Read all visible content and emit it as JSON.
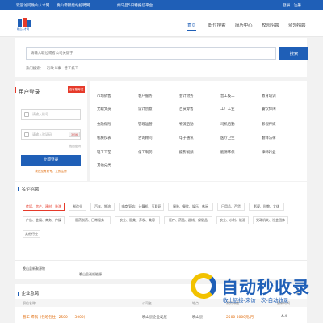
{
  "topbar": {
    "welcome": "欢迎访问晚山人才网",
    "site_name": "晚山零聚能站招聘网",
    "slogan": "如马品5日特报信平台",
    "links": "登录 | 注册"
  },
  "header": {
    "logo_text": "晚山人才网",
    "nav": [
      "首页",
      "职位搜索",
      "简历中心",
      "校园招聘",
      "蓝领招聘"
    ]
  },
  "search": {
    "placeholder": "请输入职位或者公司关键字",
    "button": "搜索",
    "hot_label": "热门搜索：",
    "hot_terms": [
      "行政人事",
      "普工技工"
    ]
  },
  "login": {
    "title": "用户登录",
    "tag": "没有账号注册",
    "username_placeholder": "请输入账号",
    "password_placeholder": "请输入验证码",
    "captcha": "3256",
    "forgot": "找回密码",
    "button": "立即登录",
    "register_hint": "我还没有账号，立即注册"
  },
  "categories": {
    "col1": [
      "市场销售",
      "文职文员",
      "金融保险",
      "机械仪表",
      "轻工工艺",
      "其他分类"
    ],
    "col2": [
      "客户服务",
      "设计创意",
      "管理运营",
      "咨询顾问",
      "化工制药"
    ],
    "col3": [
      "会计财务",
      "百货零售",
      "物流后勤",
      "电子通讯",
      "摄影视频"
    ],
    "col4": [
      "普工技工",
      "工厂工业",
      "司机后勤",
      "医疗卫生",
      "能源环保"
    ],
    "col5": [
      "教育培训",
      "餐饮休闲",
      "影视传媒",
      "翻译法律",
      "律师行业"
    ]
  },
  "industry": {
    "title": "名企招聘",
    "row1": [
      "传媒、房产、建材、装潢",
      "制造业",
      "汽车、物流",
      "电商/网店、计算机、互联网",
      "服装、餐饮、娱乐、休闲",
      "日用品、百货",
      "影视、科教、文体"
    ],
    "row2": [
      "广告、会展、商务、传媒",
      "医药制药、日常服务",
      "农业、医美、养发、美容",
      "医疗、药品、器械、保健品",
      "农业、水利、能源",
      "党政机关、社会团体"
    ],
    "row3": [
      "其他行业"
    ]
  },
  "links": {
    "items": [
      "晚山县新聚源物",
      "晚山县诚顺能源"
    ]
  },
  "jobs": {
    "title": "企业急聘",
    "more": "更多",
    "headers": [
      "职位名称",
      "公司名",
      "地点",
      "薪资待遇",
      "更新时间"
    ],
    "row": {
      "title": "普工 焊锅（包吃包住+2500——3000）",
      "company": "晚山县企业发展",
      "location": "晚山县",
      "salary": "2500-3000元/月",
      "date": "4-4"
    }
  },
  "watermark": {
    "title": "自动秒收录",
    "sub": "收上链接-来访一次-自动收录"
  },
  "colors": {
    "primary": "#1f5fb7",
    "accent": "#e63a2a"
  }
}
